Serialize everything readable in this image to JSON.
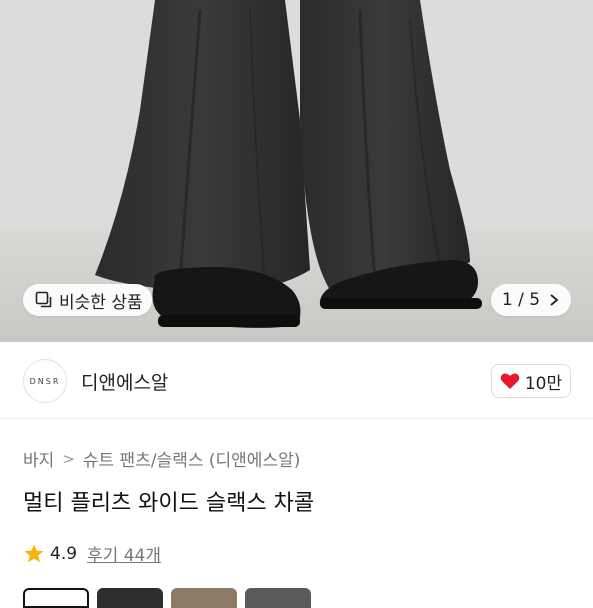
{
  "hero": {
    "similar_label": "비슷한 상품",
    "pager": "1 / 5"
  },
  "seller": {
    "logo_text": "DNSR",
    "name": "디앤에스알",
    "likes": "10만"
  },
  "breadcrumb": {
    "items": [
      "바지",
      "슈트 팬츠/슬랙스 (디앤에스알)"
    ]
  },
  "product": {
    "title": "멀티 플리츠 와이드 슬랙스 차콜",
    "rating": "4.9",
    "reviews": "후기 44개"
  },
  "colors": {
    "heart": "#e8192c",
    "star": "#f5b50a"
  }
}
